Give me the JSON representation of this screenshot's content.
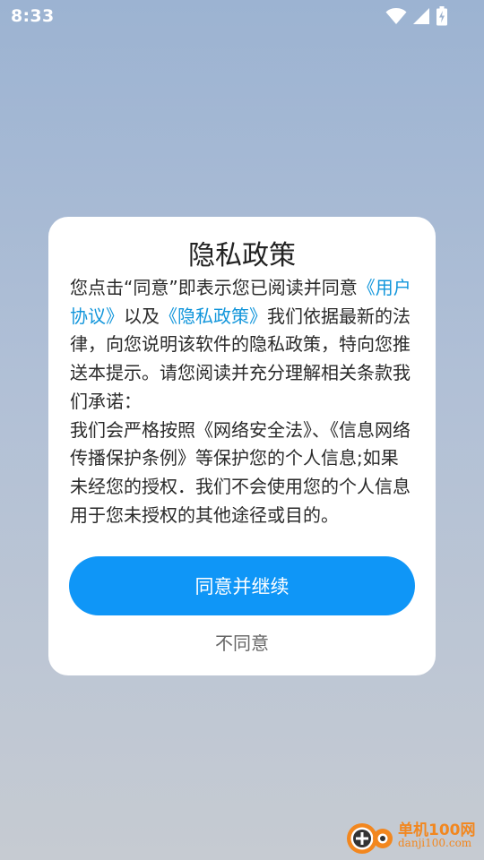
{
  "status_bar": {
    "time": "8:33",
    "icons": [
      "wifi-icon",
      "cellular-signal-icon",
      "battery-charging-icon"
    ]
  },
  "dialog": {
    "title": "隐私政策",
    "body": {
      "p1_before": "您点击“同意”即表示您已阅读并同意",
      "link_user_agreement": "《用户协议》",
      "p1_middle": "以及",
      "link_privacy_policy": "《隐私政策》",
      "p1_after": "我们依据最新的法律，向您说明该软件的隐私政策，特向您推送本提示。请您阅读并充分理解相关条款我们承诺：",
      "p2": "我们会严格按照《网络安全法》、《信息网络传播保护条例》等保护您的个人信息;如果未经您的授权．我们不会使用您的个人信息用于您未授权的其他途径或目的。"
    },
    "agree_label": "同意并继续",
    "disagree_label": "不同意"
  },
  "colors": {
    "accent": "#0f96f7",
    "link": "#1296db",
    "watermark": "#f2871f"
  },
  "watermark": {
    "name": "单机100网",
    "url": "danji100.com"
  }
}
